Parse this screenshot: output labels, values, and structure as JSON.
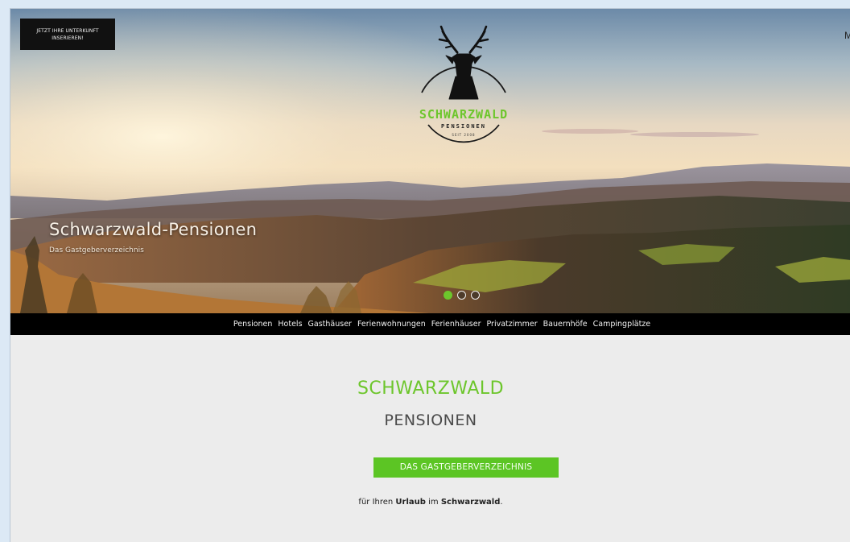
{
  "hero": {
    "insert_button": "Jetzt Ihre Unterkunft inserieren!",
    "menu_label": "M",
    "logo": {
      "icon": "deer-head-icon",
      "line1": "SCHWARZWALD",
      "line2": "PENSIONEN",
      "line3": "SEIT 2008"
    },
    "title": "Schwarzwald-Pensionen",
    "subtitle": "Das Gastgeberverzeichnis",
    "slider": {
      "slide_count": 3,
      "active_index": 0
    }
  },
  "nav": {
    "items": [
      "Pensionen",
      "Hotels",
      "Gasthäuser",
      "Ferienwohnungen",
      "Ferienhäuser",
      "Privatzimmer",
      "Bauernhöfe",
      "Campingplätze"
    ]
  },
  "content": {
    "title_line1": "SCHWARZWALD",
    "title_line2": "PENSIONEN",
    "badge": "DAS GASTGEBERVERZEICHNIS",
    "tagline": {
      "part1": "für Ihren ",
      "bold1": "Urlaub",
      "part2": " im ",
      "bold2": "Schwarzwald",
      "part3": "."
    }
  },
  "colors": {
    "accent_green": "#6dc62c",
    "badge_green": "#5cc524",
    "nav_background": "#000000",
    "content_background": "#ececec"
  }
}
